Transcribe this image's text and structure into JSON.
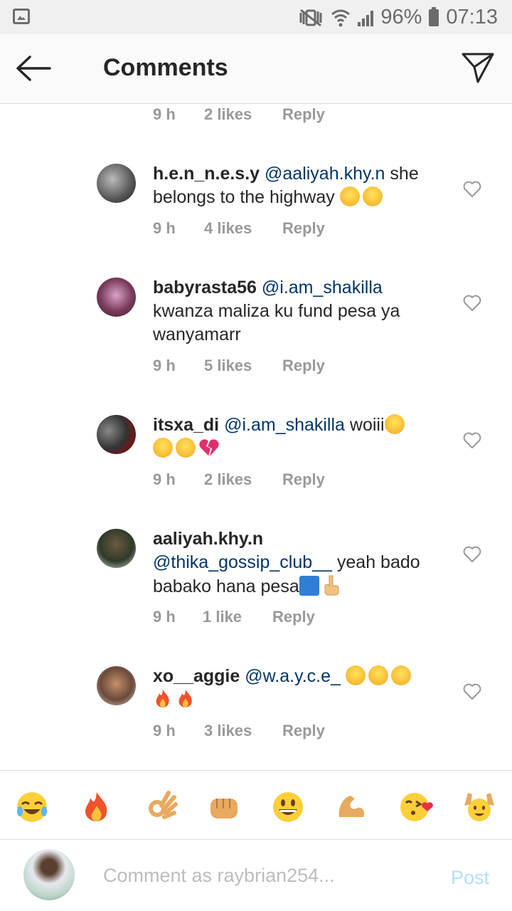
{
  "status_bar": {
    "battery": "96%",
    "time": "07:13"
  },
  "header": {
    "title": "Comments"
  },
  "top_meta": {
    "time": "9 h",
    "likes": "2 likes",
    "reply": "Reply"
  },
  "comments": [
    {
      "username": "h.e.n_n.e.s.y",
      "mention": "@aaliyah.khy.n",
      "text": " she belongs to the highway ",
      "time": "9 h",
      "likes": "4 likes",
      "reply": "Reply"
    },
    {
      "username": "babyrasta56",
      "mention": "@i.am_shakilla",
      "text": " kwanza maliza ku fund pesa ya wanyamarr",
      "time": "9 h",
      "likes": "5 likes",
      "reply": "Reply"
    },
    {
      "username": "itsxa_di",
      "mention": "@i.am_shakilla",
      "text": " woiii",
      "time": "9 h",
      "likes": "2 likes",
      "reply": "Reply"
    },
    {
      "username": "aaliyah.khy.n",
      "mention": "@thika_gossip_club__",
      "text": " yeah bado babako hana pesa",
      "time": "9 h",
      "likes": "1 like",
      "reply": "Reply"
    },
    {
      "username": "xo__aggie",
      "mention": "@w.a.y.c.e_",
      "text": " ",
      "time": "9 h",
      "likes": "3 likes",
      "reply": "Reply"
    }
  ],
  "emoji_bar": [
    "tears-of-joy",
    "fire",
    "ok-hand",
    "fist",
    "grinning",
    "flexed-biceps",
    "kissing-heart",
    "raising-hands"
  ],
  "compose": {
    "placeholder": "Comment as raybrian254...",
    "post_label": "Post"
  },
  "colors": {
    "link": "#003569",
    "meta": "#999999",
    "post": "#b2dffc"
  }
}
